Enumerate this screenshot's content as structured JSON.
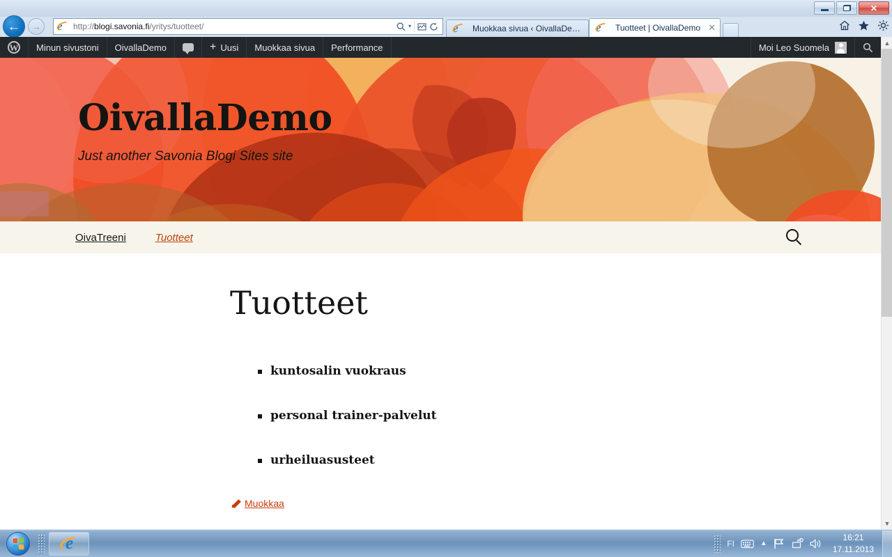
{
  "browser": {
    "window_controls": {
      "minimize": "Minimize",
      "restore": "Restore",
      "close": "Close",
      "close_glyph": "✕"
    },
    "back_glyph": "←",
    "forward_glyph": "→",
    "address": {
      "scheme": "http://",
      "host": "blogi.savonia.fi",
      "path": "/yritys/tuotteet/",
      "full": "http://blogi.savonia.fi/yritys/tuotteet/"
    },
    "address_icons": {
      "search": "search-icon",
      "search_glyph": "⌕",
      "dropdown_glyph": "▾",
      "compatibility": "compatibility-view-icon",
      "compatibility_glyph": "⛶",
      "refresh": "refresh-icon",
      "refresh_glyph": "↻"
    },
    "toolbar_icons": [
      {
        "name": "home-icon",
        "glyph": "⌂",
        "label": "Home"
      },
      {
        "name": "favorites-icon",
        "glyph": "★",
        "label": "Favorites"
      },
      {
        "name": "tools-gear-icon",
        "glyph": "⚙",
        "label": "Tools"
      }
    ],
    "tabs": [
      {
        "title": "Muokkaa sivua ‹ OivallaDemo ...",
        "active": false,
        "closable": false
      },
      {
        "title": "Tuotteet | OivallaDemo",
        "active": true,
        "closable": true,
        "close_glyph": "✕"
      }
    ],
    "new_tab_label": "New tab",
    "scrollbar": {
      "up_glyph": "▲",
      "down_glyph": "▼"
    }
  },
  "adminbar": {
    "logo": "W",
    "items": [
      {
        "label": "Minun sivustoni",
        "name": "admin-bar-my-sites"
      },
      {
        "label": "OivallaDemo",
        "name": "admin-bar-site-name"
      },
      {
        "label": "",
        "name": "admin-bar-comments",
        "icon": "comment-bubble-icon"
      },
      {
        "label": "Uusi",
        "name": "admin-bar-new",
        "icon": "plus-icon",
        "plus": "+"
      },
      {
        "label": "Muokkaa sivua",
        "name": "admin-bar-edit-page"
      },
      {
        "label": "Performance",
        "name": "admin-bar-performance"
      }
    ],
    "account": {
      "greeting": "Moi Leo Suomela",
      "avatar": "user-avatar"
    },
    "search_glyph": "⌕",
    "collapse_glyph": "⌃"
  },
  "site": {
    "title": "OivallaDemo",
    "description": "Just another Savonia Blogi Sites site",
    "header_colors": {
      "background": "#f7f2e5",
      "coral": "#f4604a",
      "orange_red": "#f04d23",
      "red": "#e8502a",
      "dark_red": "#b5311a",
      "amber": "#f0a13c",
      "tan": "#f2c98a",
      "brown": "#b5702f"
    }
  },
  "nav": {
    "items": [
      {
        "label": "OivaTreeni",
        "current": false,
        "name": "nav-item-oivatreeni"
      },
      {
        "label": "Tuotteet",
        "current": true,
        "name": "nav-item-tuotteet"
      }
    ],
    "search_icon": "search-icon"
  },
  "page": {
    "title": "Tuotteet",
    "list": [
      "kuntosalin vuokraus",
      "personal trainer-palvelut",
      "urheiluasusteet"
    ],
    "edit_link": {
      "label": "Muokkaa",
      "icon": "pencil-icon",
      "color": "#ca3c08"
    }
  },
  "taskbar": {
    "start": "start-orb",
    "buttons": [
      {
        "name": "taskbar-button-internet-explorer",
        "label": "Internet Explorer",
        "active": true
      }
    ],
    "tray": {
      "language": "FI",
      "items": [
        {
          "name": "keyboard-layout-icon",
          "glyph": "⌨"
        },
        {
          "name": "show-hidden-icons-chevron",
          "glyph": "▴"
        },
        {
          "name": "action-center-flag-icon",
          "glyph": "⚑"
        },
        {
          "name": "network-icon",
          "glyph": "὚7"
        },
        {
          "name": "volume-icon",
          "glyph": "🔊"
        }
      ],
      "time": "16:21",
      "date": "17.11.2013"
    }
  }
}
